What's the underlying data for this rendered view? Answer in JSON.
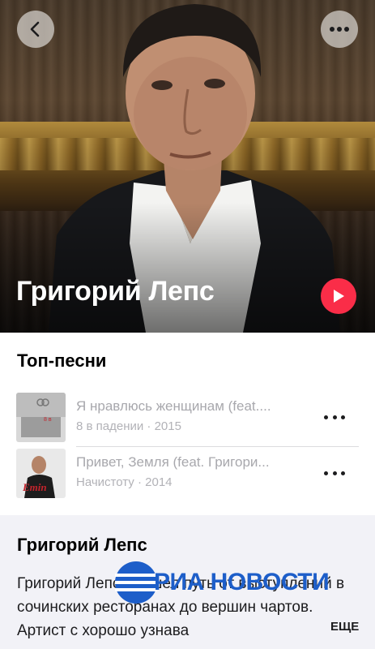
{
  "hero": {
    "artist_name": "Григорий Лепс",
    "back_icon": "chevron-left-icon",
    "more_icon": "ellipsis-icon",
    "play_icon": "play-icon",
    "accent_color": "#fa2d48"
  },
  "top_songs": {
    "title": "Топ-песни",
    "items": [
      {
        "title": "Я нравлюсь женщинам (feat....",
        "album": "8 в падении",
        "year": "2015",
        "separator": " · "
      },
      {
        "title": "Привет, Земля (feat. Григори...",
        "album": "Начистоту",
        "year": "2014",
        "separator": " · "
      }
    ]
  },
  "about": {
    "title": "Григорий Лепс",
    "text": "Григорий Лепс прошел путь от выступлений в сочинских ресторанах до вершин чартов. Артист с хорошо узнава",
    "more_label": "ЕЩЕ"
  },
  "watermark": {
    "text": "РИА НОВОСТИ",
    "color": "#1d5ec9"
  }
}
